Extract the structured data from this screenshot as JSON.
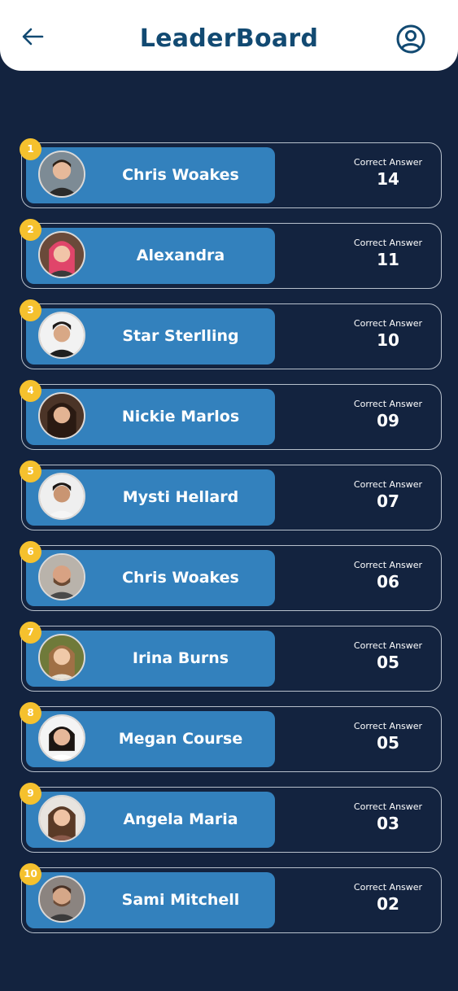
{
  "header": {
    "title": "LeaderBoard",
    "back_icon": "arrow-left-icon",
    "profile_icon": "user-circle-icon",
    "title_color": "#124a72"
  },
  "colors": {
    "background": "#13233f",
    "pill": "#3381bd",
    "rank_badge": "#f5c12e",
    "row_border": "#b7c0cc"
  },
  "entries": [
    {
      "rank": "1",
      "name": "Chris Woakes",
      "label": "Correct Answer",
      "score": "14",
      "avatar": "avatar-icon"
    },
    {
      "rank": "2",
      "name": "Alexandra",
      "label": "Correct Answer",
      "score": "11",
      "avatar": "avatar-icon"
    },
    {
      "rank": "3",
      "name": "Star Sterlling",
      "label": "Correct Answer",
      "score": "10",
      "avatar": "avatar-icon"
    },
    {
      "rank": "4",
      "name": "Nickie Marlos",
      "label": "Correct Answer",
      "score": "09",
      "avatar": "avatar-icon"
    },
    {
      "rank": "5",
      "name": "Mysti Hellard",
      "label": "Correct Answer",
      "score": "07",
      "avatar": "avatar-icon"
    },
    {
      "rank": "6",
      "name": "Chris Woakes",
      "label": "Correct Answer",
      "score": "06",
      "avatar": "avatar-icon"
    },
    {
      "rank": "7",
      "name": "Irina Burns",
      "label": "Correct Answer",
      "score": "05",
      "avatar": "avatar-icon"
    },
    {
      "rank": "8",
      "name": "Megan Course",
      "label": "Correct Answer",
      "score": "05",
      "avatar": "avatar-icon"
    },
    {
      "rank": "9",
      "name": "Angela Maria",
      "label": "Correct Answer",
      "score": "03",
      "avatar": "avatar-icon"
    },
    {
      "rank": "10",
      "name": "Sami Mitchell",
      "label": "Correct Answer",
      "score": "02",
      "avatar": "avatar-icon"
    }
  ]
}
